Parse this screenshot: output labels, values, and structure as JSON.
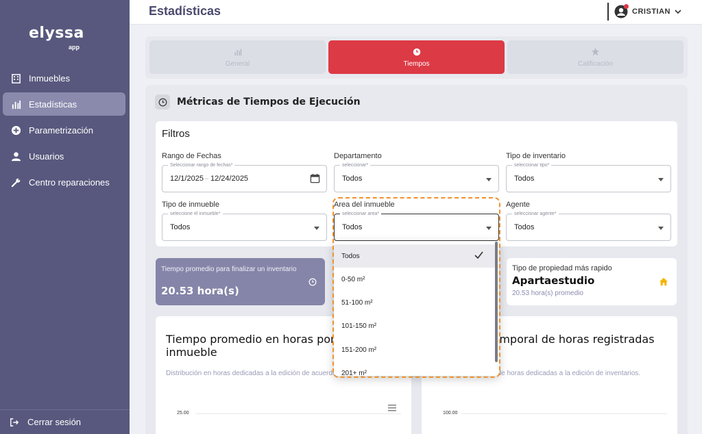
{
  "app": {
    "logo_text": "elyssa",
    "logo_sub": "app",
    "page_title": "Estadísticas",
    "user_name": "CRISTIAN"
  },
  "sidebar": {
    "items": [
      {
        "label": "Inmuebles",
        "icon": "building-icon",
        "active": false
      },
      {
        "label": "Estadísticas",
        "icon": "bar-chart-icon",
        "active": true
      },
      {
        "label": "Parametrización",
        "icon": "plus-circle-icon",
        "active": false
      },
      {
        "label": "Usuarios",
        "icon": "user-icon",
        "active": false
      },
      {
        "label": "Centro reparaciones",
        "icon": "wrench-icon",
        "active": false
      }
    ],
    "logout_label": "Cerrar sesión"
  },
  "tabs": [
    {
      "label": "General",
      "icon": "bar-chart-icon",
      "active": false
    },
    {
      "label": "Tiempos",
      "icon": "clock-icon",
      "active": true
    },
    {
      "label": "Calificación",
      "icon": "star-icon",
      "active": false
    }
  ],
  "section": {
    "title": "Métricas de Tiempos de Ejecución"
  },
  "filters": {
    "title": "Filtros",
    "date_range": {
      "label": "Rango de Fechas",
      "legend": "Seleccionar rango de fechas*",
      "start": "12/1/2025",
      "separator": "–",
      "end": "12/24/2025"
    },
    "departamento": {
      "label": "Departamento",
      "legend": "seleccionar*",
      "value": "Todos"
    },
    "tipo_inventario": {
      "label": "Tipo de inventario",
      "legend": "seleccionar tipo*",
      "value": "Todos"
    },
    "tipo_inmueble": {
      "label": "Tipo de inmueble",
      "legend": "seleccione el inmueble*",
      "value": "Todos"
    },
    "area_inmueble": {
      "label": "Area del inmueble",
      "legend": "seleccionar area*",
      "value": "Todos"
    },
    "agente": {
      "label": "Agente",
      "legend": "seleccionar agente*",
      "value": "Todos"
    }
  },
  "area_dropdown": {
    "options": [
      "Todos",
      "0-50 m²",
      "51-100 m²",
      "101-150 m²",
      "151-200 m²",
      "201+ m²"
    ],
    "selected": "Todos"
  },
  "kpis": {
    "avg_time": {
      "label": "Tiempo promedio para finalizar un inventario",
      "value": "20.53 hora(s)"
    },
    "fastest_type": {
      "label": "Tipo de propiedad más rapido",
      "value": "Apartaestudio",
      "sub": "20.53 hora(s) promedio"
    }
  },
  "charts": {
    "left": {
      "title": "Tiempo promedio en horas por tipo de inmueble",
      "desc": "Distribución en horas dedicadas a la edición de acuerdo al area y el tipo.",
      "top_tick": "25.00"
    },
    "right": {
      "title": "Evolución temporal de horas registradas",
      "desc": "Distribución mensual de horas dedicadas a la edición de inventarios.",
      "top_tick": "100.00"
    }
  },
  "chart_data": [
    {
      "type": "bar",
      "title": "Tiempo promedio en horas por tipo de inmueble",
      "y_ticks": [
        "25.00"
      ]
    },
    {
      "type": "line",
      "title": "Evolución temporal de horas registradas",
      "y_ticks": [
        "100.00"
      ]
    }
  ],
  "colors": {
    "sidebar": "#58587e",
    "accent_red": "#dc3a45",
    "kpi_purple": "#8585a9",
    "highlight": "#f0922b"
  }
}
